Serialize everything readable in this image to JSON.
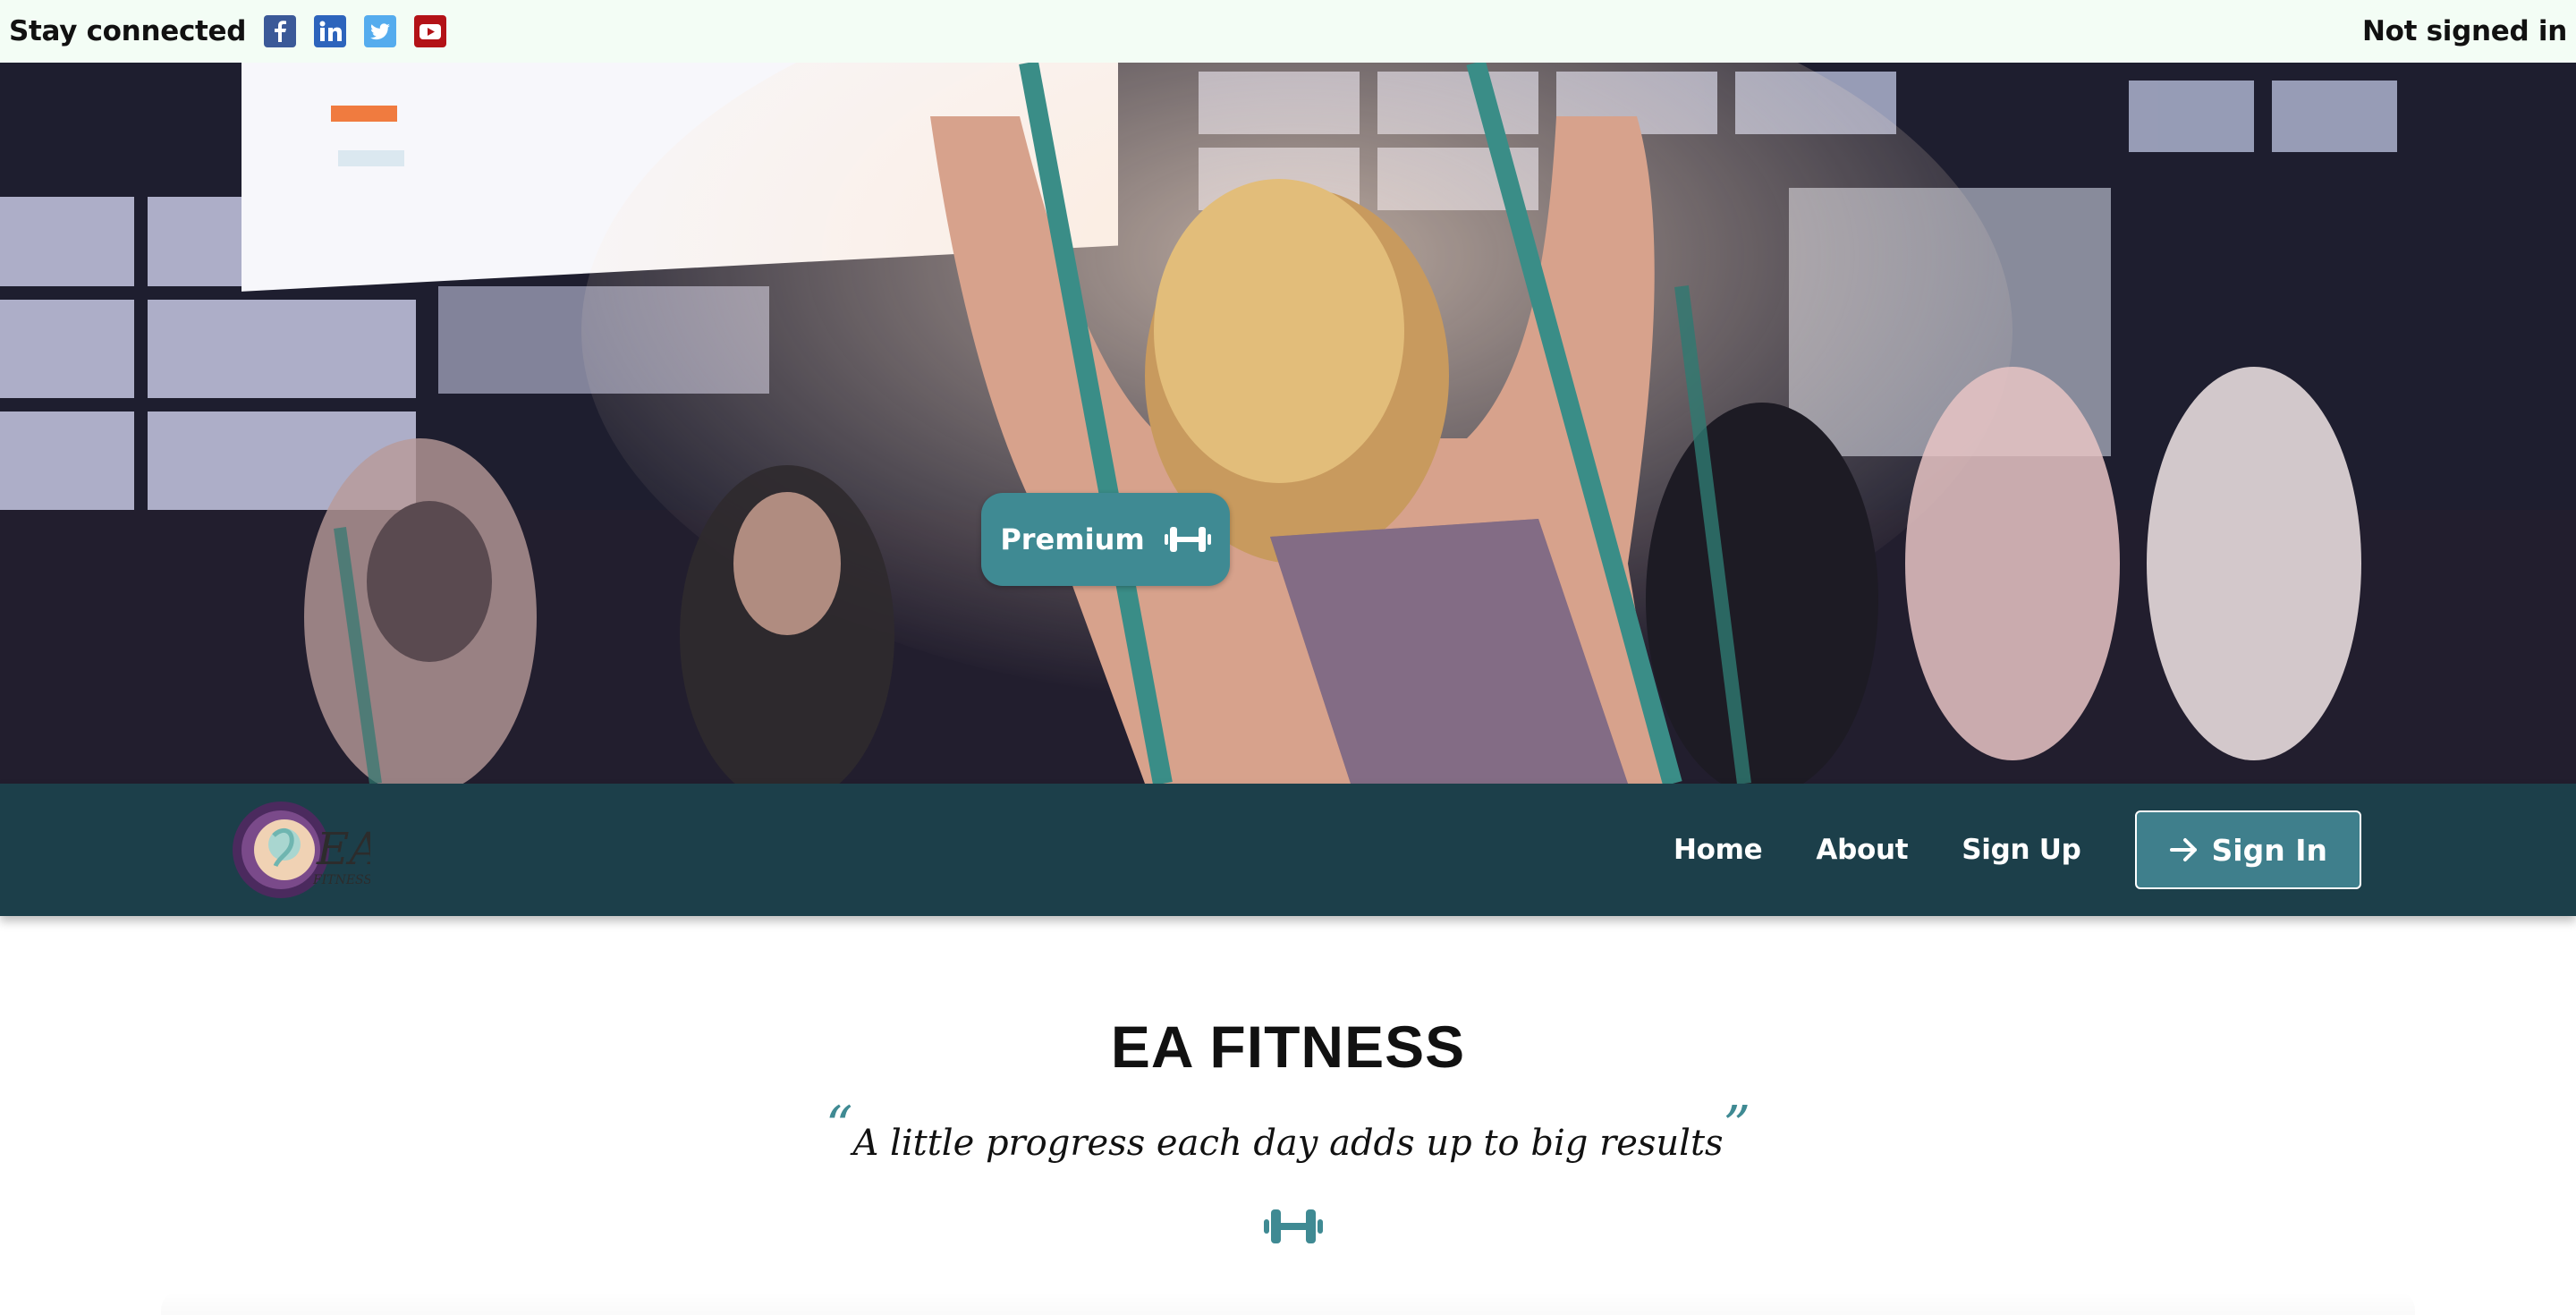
{
  "topbar": {
    "stay_connected": "Stay connected",
    "social": [
      {
        "icon": "facebook-icon",
        "color": "#3b5998"
      },
      {
        "icon": "linkedin-icon",
        "color": "#2d64bc"
      },
      {
        "icon": "twitter-icon",
        "color": "#55acee"
      },
      {
        "icon": "youtube-icon",
        "color": "#b31217"
      }
    ],
    "status": "Not signed in"
  },
  "hero": {
    "premium_label": "Premium",
    "premium_icon": "dumbbell-icon"
  },
  "nav": {
    "logo_icon": "ea-fitness-logo",
    "links": [
      "Home",
      "About",
      "Sign Up"
    ],
    "signin_label": "Sign In",
    "signin_icon": "arrow-right-icon"
  },
  "main": {
    "title": "EA FITNESS",
    "quote": "A little progress each day adds up to big results",
    "open_quote": "“",
    "close_quote": "”",
    "icon": "dumbbell-icon"
  },
  "colors": {
    "topbar_bg": "#f3fdf5",
    "nav_bg": "#1c3f4a",
    "accent": "#3f8a93"
  }
}
